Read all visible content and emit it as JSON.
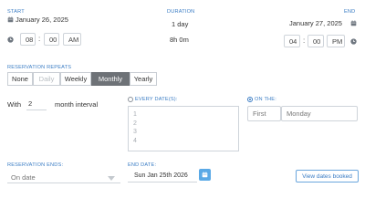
{
  "start": {
    "label": "START",
    "date": "January 26, 2025",
    "time": {
      "hour": "08",
      "minute": "00",
      "ampm": "AM"
    }
  },
  "duration": {
    "label": "DURATION",
    "days": "1 day",
    "hours": "8h 0m"
  },
  "end": {
    "label": "END",
    "date": "January 27, 2025",
    "time": {
      "hour": "04",
      "minute": "00",
      "ampm": "PM"
    }
  },
  "repeats": {
    "label": "RESERVATION REPEATS",
    "options": [
      "None",
      "Daily",
      "Weekly",
      "Monthly",
      "Yearly"
    ],
    "selected": "Monthly"
  },
  "interval": {
    "prefix": "With",
    "value": "2",
    "suffix": "month interval"
  },
  "every_dates": {
    "label": "EVERY DATE(S):",
    "items": [
      "1",
      "2",
      "3",
      "4"
    ]
  },
  "on_the": {
    "label": "ON THE:",
    "ordinal": "First",
    "weekday": "Monday"
  },
  "ends": {
    "label": "RESERVATION ENDS:",
    "value": "On date"
  },
  "end_date": {
    "label": "END DATE:",
    "value": "Sun Jan 25th 2026"
  },
  "view_booked": {
    "label": "View dates booked"
  },
  "colors": {
    "accent": "#3a7cc4",
    "active_segment": "#6e7277",
    "calendar_button": "#5aa9e6"
  }
}
